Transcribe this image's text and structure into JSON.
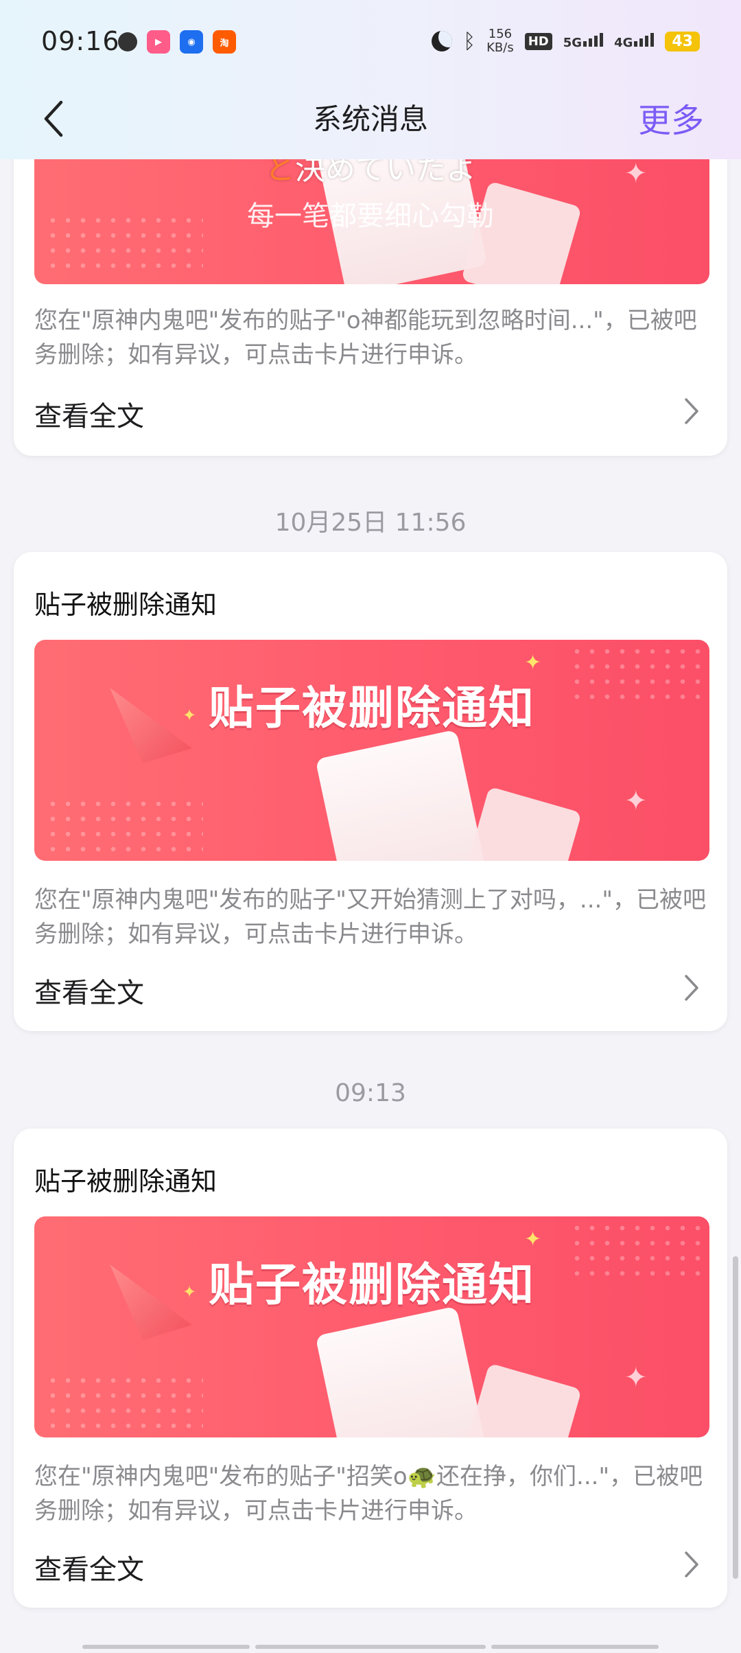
{
  "status_bar": {
    "time": "09:16",
    "net_speed_value": "156",
    "net_speed_unit": "KB/s",
    "hd_label": "HD",
    "sim1": "1",
    "sim2": "2",
    "network_5g": "5G",
    "network_4g": "4G",
    "battery": "43"
  },
  "nav": {
    "title": "系统消息",
    "more_label": "更多"
  },
  "overlay_subtitles": {
    "line1_highlight": "と",
    "line1_rest": "決めていたよ",
    "line2": "每一笔都要细心勾勒"
  },
  "messages": [
    {
      "description": "您在\"原神内鬼吧\"发布的贴子\"o神都能玩到忽略时间...\"，已被吧务删除；如有异议，可点击卡片进行申诉。",
      "view_all_label": "查看全文"
    },
    {
      "timestamp": "10月25日 11:56",
      "title": "贴子被删除通知",
      "banner_text": "贴子被删除通知",
      "description": "您在\"原神内鬼吧\"发布的贴子\"又开始猜测上了对吗，...\"，已被吧务删除；如有异议，可点击卡片进行申诉。",
      "view_all_label": "查看全文"
    },
    {
      "timestamp": "09:13",
      "title": "贴子被删除通知",
      "banner_text": "贴子被删除通知",
      "description": "您在\"原神内鬼吧\"发布的贴子\"招笑o🐢还在挣，你们...\"，已被吧务删除；如有异议，可点击卡片进行申诉。",
      "view_all_label": "查看全文"
    }
  ],
  "colors": {
    "accent": "#7b5cf5",
    "banner": "#ff5a6d",
    "page_bg": "#f3f3f8"
  }
}
